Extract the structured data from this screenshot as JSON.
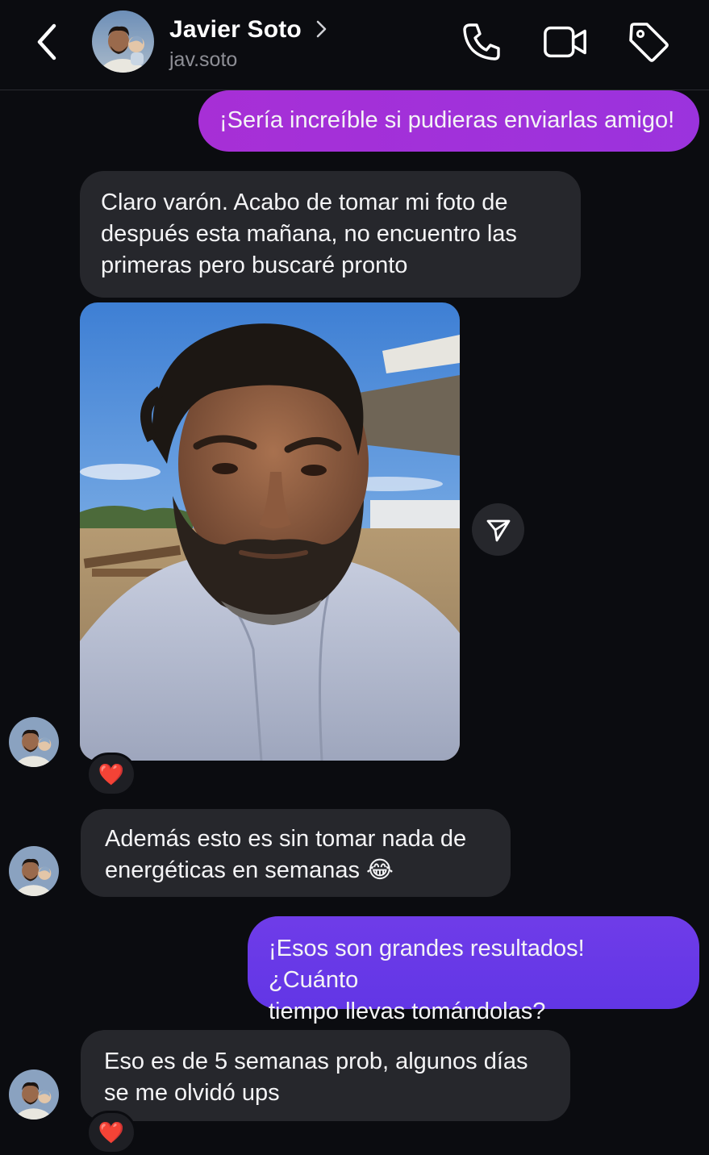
{
  "header": {
    "contact_name": "Javier Soto",
    "contact_handle": "jav.soto",
    "icons": [
      "back-icon",
      "chevron-right-icon",
      "phone-icon",
      "video-camera-icon",
      "tag-icon"
    ]
  },
  "messages": [
    {
      "direction": "outgoing",
      "text": "¡Sería increíble si pudieras enviarlas amigo!"
    },
    {
      "direction": "incoming",
      "text": "Claro varón. Acabo de tomar mi foto de\ndespués esta mañana, no encuentro las\nprimeras pero buscaré pronto"
    },
    {
      "direction": "incoming",
      "type": "photo",
      "reaction": "❤️"
    },
    {
      "direction": "incoming",
      "text": "Además esto es sin tomar nada de\nenergéticas en semanas 😂"
    },
    {
      "direction": "outgoing",
      "text": "¡Esos son grandes resultados! ¿Cuánto\ntiempo llevas tomándolas?"
    },
    {
      "direction": "incoming",
      "text": "Eso es de 5 semanas prob, algunos días\nse me olvidó ups",
      "reaction": "❤️"
    }
  ],
  "colors": {
    "background": "#0b0c10",
    "incoming_bubble": "#26272c",
    "outgoing_gradient_top": "#a72fd6",
    "outgoing_gradient_bottom": "#6a3be8",
    "secondary_text": "#8e8f96"
  }
}
